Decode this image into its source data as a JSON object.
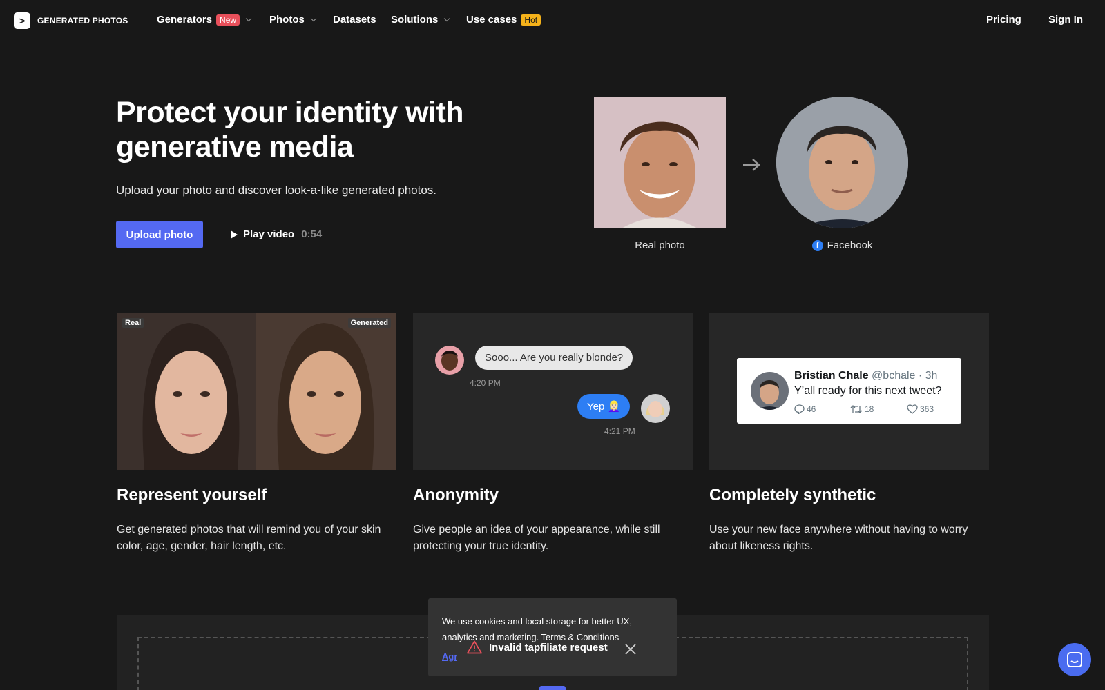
{
  "nav": {
    "logo_text": "GENERATED PHOTOS",
    "generators": "Generators",
    "new_badge": "New",
    "photos": "Photos",
    "datasets": "Datasets",
    "solutions": "Solutions",
    "use_cases": "Use cases",
    "hot_badge": "Hot",
    "pricing": "Pricing",
    "sign_in": "Sign In"
  },
  "hero": {
    "title": "Protect your identity with generative media",
    "subtitle": "Upload your photo and discover look-a-like generated photos.",
    "upload_button": "Upload photo",
    "play_label": "Play video",
    "play_duration": "0:54",
    "real_caption": "Real photo",
    "facebook_caption": "Facebook"
  },
  "cards": [
    {
      "title": "Represent yourself",
      "desc": "Get generated photos that will remind you of your skin color, age, gender, hair length, etc.",
      "tag_left": "Real",
      "tag_right": "Generated"
    },
    {
      "title": "Anonymity",
      "desc": "Give people an idea of your appearance, while still protecting your true identity.",
      "msg1": "Sooo... Are you really blonde?",
      "time1": "4:20 PM",
      "msg2": "Yep 👱🏻‍♀️",
      "time2": "4:21 PM"
    },
    {
      "title": "Completely synthetic",
      "desc": "Use your new face anywhere without having to worry about likeness rights.",
      "tweet_name": "Bristian Chale",
      "tweet_handle": "@bchale · 3h",
      "tweet_text": "Y’all ready for this next tweet?",
      "replies": "46",
      "retweets": "18",
      "likes": "363"
    }
  ],
  "cookie": {
    "text": "We use cookies and local storage for better UX, analytics and marketing. Terms & Conditions",
    "agree": "Agree"
  },
  "toast": {
    "message": "Invalid tapfiliate request"
  },
  "colors": {
    "accent": "#5469f2",
    "background": "#181818",
    "card": "#272727"
  }
}
